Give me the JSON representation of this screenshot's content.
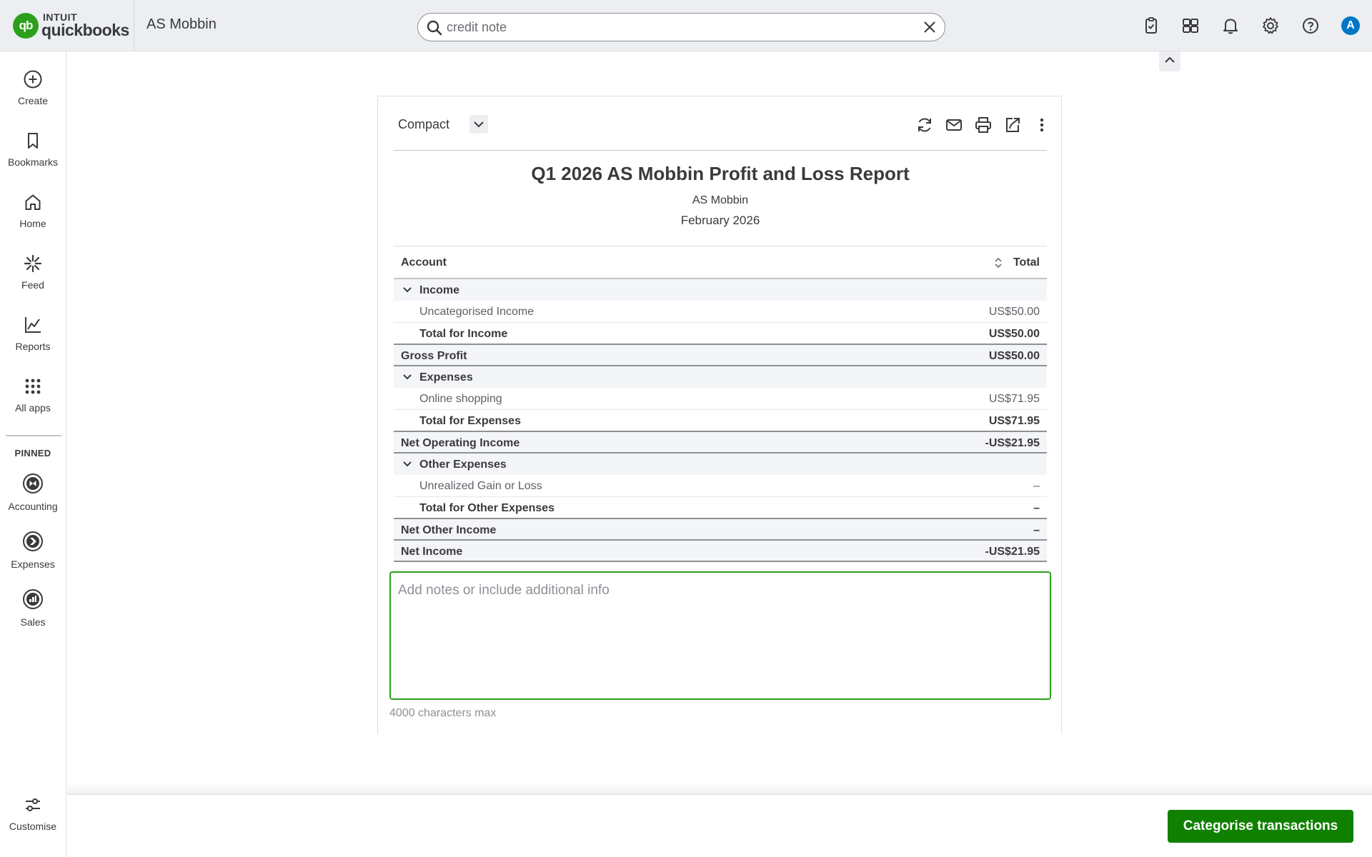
{
  "app": {
    "brand_top": "INTUIT",
    "brand_bottom": "quickbooks",
    "logo_mark": "qb",
    "company": "AS Mobbin",
    "accent_color": "#2ca01c"
  },
  "search": {
    "value": "credit note",
    "placeholder": "credit note"
  },
  "topbar": {
    "icons": [
      "tasks-icon",
      "apps-switch-icon",
      "bell-icon",
      "gear-icon",
      "help-icon"
    ],
    "avatar_initial": "A"
  },
  "nav": {
    "items": [
      {
        "label": "Create",
        "icon": "plus-circle-icon"
      },
      {
        "label": "Bookmarks",
        "icon": "bookmark-icon"
      },
      {
        "label": "Home",
        "icon": "home-icon"
      },
      {
        "label": "Feed",
        "icon": "feed-icon"
      },
      {
        "label": "Reports",
        "icon": "reports-icon"
      },
      {
        "label": "All apps",
        "icon": "grid-icon"
      }
    ],
    "pinned_heading": "PINNED",
    "pinned": [
      {
        "label": "Accounting",
        "icon": "accounting-icon"
      },
      {
        "label": "Expenses",
        "icon": "expenses-icon"
      },
      {
        "label": "Sales",
        "icon": "sales-icon"
      }
    ],
    "customise_label": "Customise"
  },
  "report": {
    "view_label": "Compact",
    "title": "Q1 2026 AS Mobbin Profit and Loss Report",
    "company": "AS Mobbin",
    "period": "February 2026",
    "col_account": "Account",
    "col_total": "Total",
    "rows": [
      {
        "type": "section",
        "label": "Income",
        "value": ""
      },
      {
        "type": "item",
        "label": "Uncategorised Income",
        "value": "US$50.00"
      },
      {
        "type": "subtotal",
        "label": "Total for Income",
        "value": "US$50.00"
      },
      {
        "type": "total",
        "label": "Gross Profit",
        "value": "US$50.00"
      },
      {
        "type": "section",
        "label": "Expenses",
        "value": ""
      },
      {
        "type": "item",
        "label": "Online shopping",
        "value": "US$71.95"
      },
      {
        "type": "subtotal",
        "label": "Total for Expenses",
        "value": "US$71.95"
      },
      {
        "type": "total",
        "label": "Net Operating Income",
        "value": "-US$21.95"
      },
      {
        "type": "section",
        "label": "Other Expenses",
        "value": ""
      },
      {
        "type": "item",
        "label": "Unrealized Gain or Loss",
        "value": "–"
      },
      {
        "type": "subtotal",
        "label": "Total for Other Expenses",
        "value": "–"
      },
      {
        "type": "total",
        "label": "Net Other Income",
        "value": "–"
      },
      {
        "type": "total",
        "label": "Net Income",
        "value": "-US$21.95"
      }
    ],
    "notes_placeholder": "Add notes or include additional info",
    "notes_hint": "4000 characters max"
  },
  "footer": {
    "cta_label": "Categorise transactions"
  }
}
